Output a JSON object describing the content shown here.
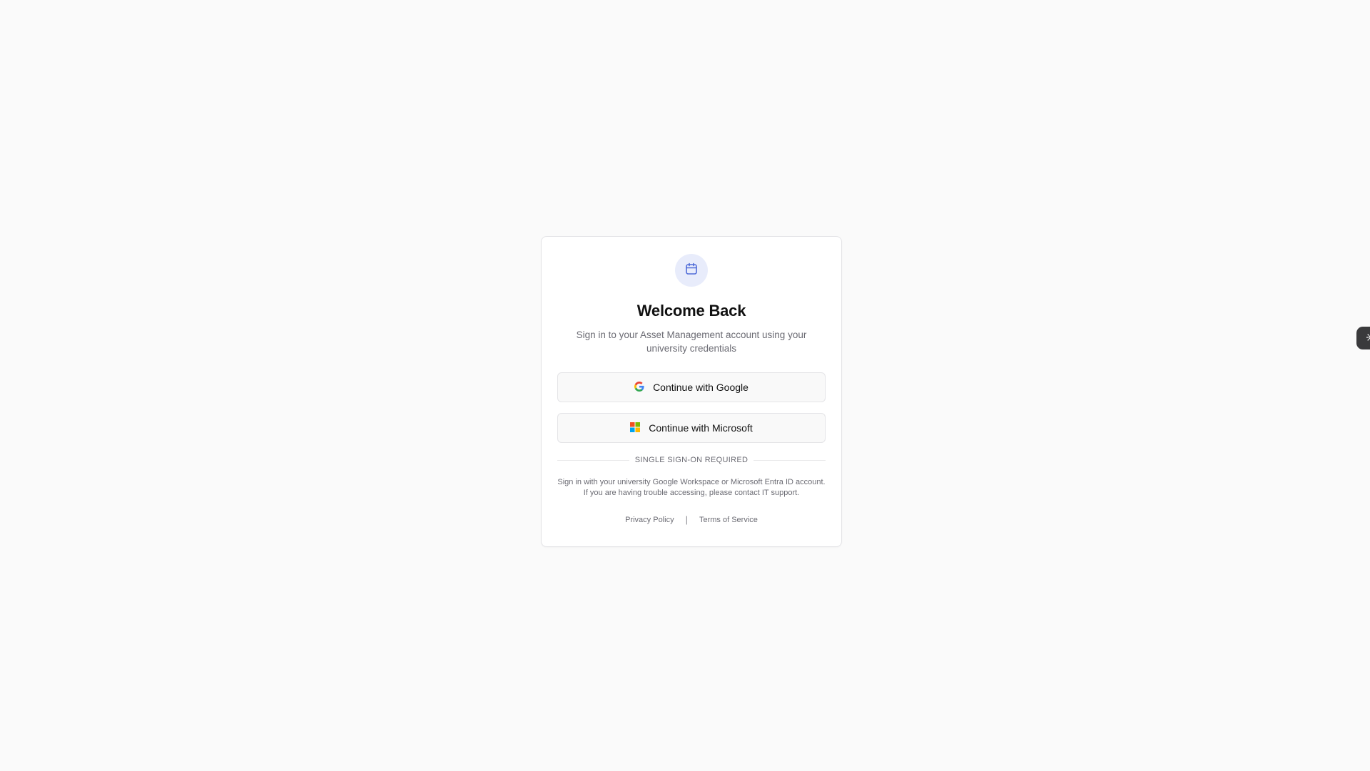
{
  "card": {
    "logo_icon": "calendar-box-icon",
    "title": "Welcome Back",
    "subtitle": "Sign in to your Asset Management account using your university credentials"
  },
  "buttons": {
    "google": {
      "label": "Continue with Google",
      "icon": "google-g-icon"
    },
    "microsoft": {
      "label": "Continue with Microsoft",
      "icon": "microsoft-logo-icon"
    }
  },
  "divider": {
    "label": "SINGLE SIGN-ON REQUIRED"
  },
  "note": "Sign in with your university Google Workspace or Microsoft Entra ID account. If you are having trouble accessing, please contact IT support.",
  "footer": {
    "privacy": "Privacy Policy",
    "separator": "|",
    "terms": "Terms of Service"
  },
  "side_tab": {
    "icon": "sun-icon"
  },
  "colors": {
    "background": "#fafafa",
    "accent": "#4f6bd8",
    "logo_bg": "#e8ecfb",
    "text_muted": "#6b6b73"
  }
}
